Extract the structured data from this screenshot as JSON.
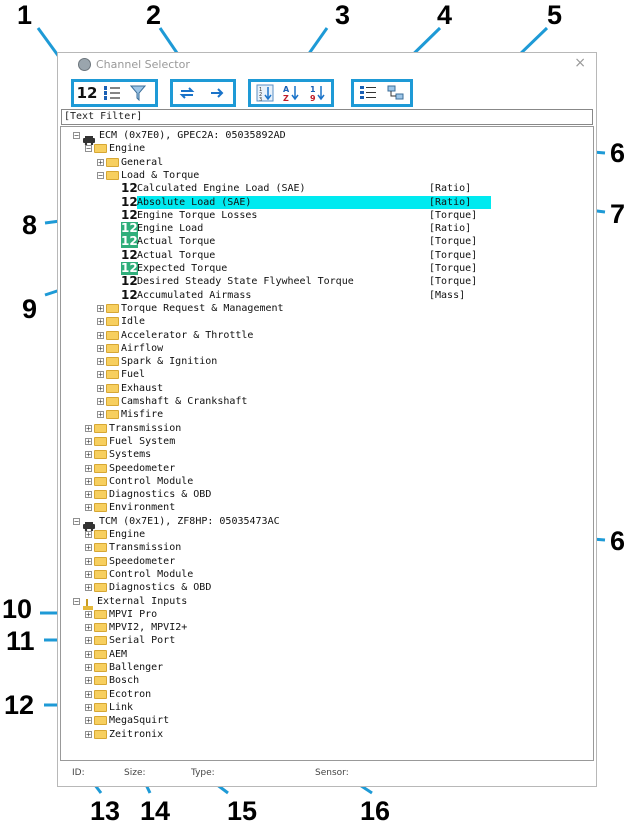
{
  "window": {
    "title": "Channel Selector",
    "close": "×"
  },
  "toolbar": {
    "b1": "12",
    "b3": "1\n2\n3",
    "az": "A\nZ",
    "nine": "1\n9"
  },
  "filter": {
    "text": "[Text Filter]"
  },
  "tree": {
    "ecm": "ECM (0x7E0), GPEC2A: 05035892AD",
    "engine": "Engine",
    "general": "General",
    "load_torque": "Load & Torque",
    "channels": [
      {
        "name": "Calculated Engine Load (SAE)",
        "type": "[Ratio]"
      },
      {
        "name": "Absolute Load (SAE)",
        "type": "[Ratio]"
      },
      {
        "name": "Engine Torque Losses",
        "type": "[Torque]"
      },
      {
        "name": "Engine Load",
        "type": "[Ratio]"
      },
      {
        "name": "Actual Torque",
        "type": "[Torque]"
      },
      {
        "name": "Actual Torque",
        "type": "[Torque]"
      },
      {
        "name": "Expected Torque",
        "type": "[Torque]"
      },
      {
        "name": "Desired Steady State Flywheel Torque",
        "type": "[Torque]"
      },
      {
        "name": "Accumulated Airmass",
        "type": "[Mass]"
      }
    ],
    "engine_groups": [
      "Torque Request & Management",
      "Idle",
      "Accelerator & Throttle",
      "Airflow",
      "Spark & Ignition",
      "Fuel",
      "Exhaust",
      "Camshaft & Crankshaft",
      "Misfire"
    ],
    "ecm_groups": [
      "Transmission",
      "Fuel System",
      "Systems",
      "Speedometer",
      "Control Module",
      "Diagnostics & OBD",
      "Environment"
    ],
    "tcm": "TCM (0x7E1), ZF8HP: 05035473AC",
    "tcm_groups": [
      "Engine",
      "Transmission",
      "Speedometer",
      "Control Module",
      "Diagnostics & OBD"
    ],
    "external": "External Inputs",
    "ext_groups": [
      "MPVI Pro",
      "MPVI2, MPVI2+",
      "Serial Port",
      "AEM",
      "Ballenger",
      "Bosch",
      "Ecotron",
      "Link",
      "MegaSquirt",
      "Zeitronix"
    ]
  },
  "status": {
    "id": "ID:",
    "size": "Size:",
    "type": "Type:",
    "sensor": "Sensor:"
  },
  "callouts": [
    "1",
    "2",
    "3",
    "4",
    "5",
    "6",
    "7",
    "8",
    "9",
    "10",
    "11",
    "12",
    "13",
    "14",
    "15",
    "16",
    "6"
  ],
  "colors": {
    "callout_line": "#1e9ad6",
    "highlight": "#00eaf0",
    "green_icon": "#2fae7a",
    "folder": "#f7cf5f"
  }
}
